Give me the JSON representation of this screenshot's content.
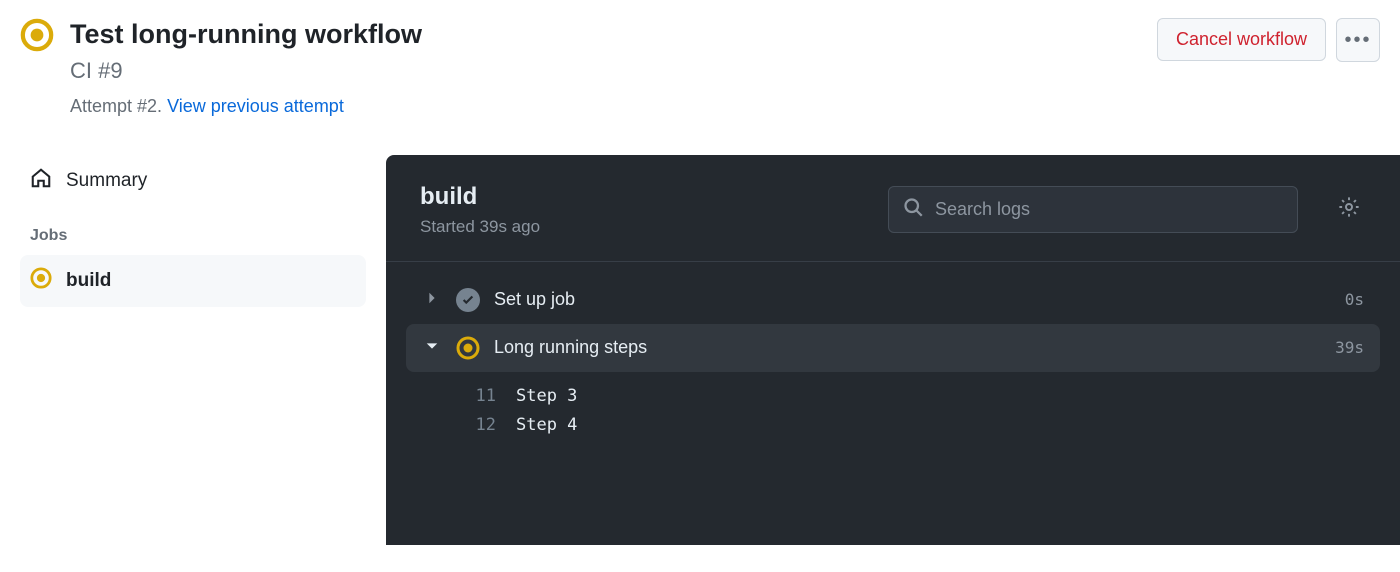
{
  "header": {
    "title": "Test long-running workflow",
    "subtitle": "CI #9",
    "attempt_prefix": "Attempt #2. ",
    "attempt_link": "View previous attempt",
    "cancel_label": "Cancel workflow"
  },
  "sidebar": {
    "summary_label": "Summary",
    "jobs_heading": "Jobs",
    "job_name": "build"
  },
  "job": {
    "title": "build",
    "started": "Started 39s ago",
    "search_placeholder": "Search logs"
  },
  "steps": [
    {
      "name": "Set up job",
      "duration": "0s",
      "status": "success",
      "expanded": false
    },
    {
      "name": "Long running steps",
      "duration": "39s",
      "status": "running",
      "expanded": true
    }
  ],
  "log_lines": [
    {
      "num": "11",
      "text": "Step 3"
    },
    {
      "num": "12",
      "text": "Step 4"
    }
  ],
  "colors": {
    "running": "#dbab0a",
    "danger": "#cf222e",
    "link": "#0969da"
  }
}
